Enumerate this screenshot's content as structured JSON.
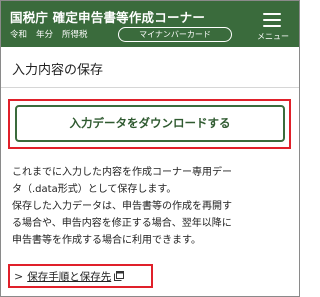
{
  "header": {
    "title": "国税庁 確定申告書等作成コーナー",
    "sub": [
      "令和",
      "年分",
      "所得税"
    ],
    "mynumber_button": "マイナンバーカード",
    "menu_label": "メニュー",
    "menu_icon": "hamburger-menu-icon",
    "background": "#3a6b3c"
  },
  "section": {
    "title": "入力内容の保存"
  },
  "download_button": {
    "label": "入力データをダウンロードする",
    "border_color": "#3a6b3c"
  },
  "description": {
    "lines": [
      "これまでに入力した内容を作成コーナー専用デー",
      "タ（.data形式）として保存します。",
      "保存した入力データは、申告書等の作成を再開す",
      "る場合や、申告内容を修正する場合、翌年以降に",
      "申告書等を作成する場合に利用できます。"
    ]
  },
  "link": {
    "chevron_icon": "chevron-right-icon",
    "label": "保存手順と保存先",
    "external_icon": "external-link-icon"
  },
  "highlight_color": "#e0202a"
}
